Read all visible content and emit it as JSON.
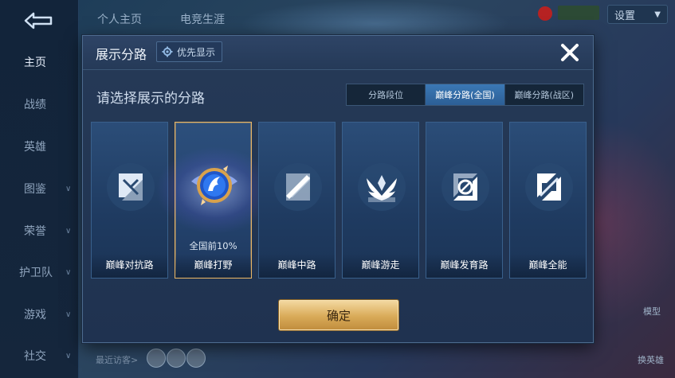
{
  "sidebar": {
    "items": [
      {
        "label": "主页",
        "active": true,
        "chevron": false
      },
      {
        "label": "战绩",
        "active": false,
        "chevron": false
      },
      {
        "label": "英雄",
        "active": false,
        "chevron": false
      },
      {
        "label": "图鉴",
        "active": false,
        "chevron": true
      },
      {
        "label": "荣誉",
        "active": false,
        "chevron": true
      },
      {
        "label": "护卫队",
        "active": false,
        "chevron": true
      },
      {
        "label": "游戏",
        "active": false,
        "chevron": true
      },
      {
        "label": "社交",
        "active": false,
        "chevron": true
      }
    ]
  },
  "top_tabs": [
    "个人主页",
    "电竞生涯"
  ],
  "settings": {
    "label": "设置"
  },
  "bottom": {
    "recent_visitors": "最近访客>"
  },
  "right_labels": {
    "model": "模型",
    "change_hero": "换英雄"
  },
  "modal": {
    "title": "展示分路",
    "priority_label": "优先显示",
    "prompt": "请选择展示的分路",
    "segments": [
      {
        "label": "分路段位",
        "active": false
      },
      {
        "label": "巅峰分路(全国)",
        "active": true
      },
      {
        "label": "巅峰分路(战区)",
        "active": false
      }
    ],
    "cards": [
      {
        "label": "巅峰对抗路",
        "icon": "sword-shield-icon",
        "selected": false,
        "rank": ""
      },
      {
        "label": "巅峰打野",
        "icon": "jungle-emblem-icon",
        "selected": true,
        "rank": "全国前10%"
      },
      {
        "label": "巅峰中路",
        "icon": "mid-lane-icon",
        "selected": false,
        "rank": ""
      },
      {
        "label": "巅峰游走",
        "icon": "wings-icon",
        "selected": false,
        "rank": ""
      },
      {
        "label": "巅峰发育路",
        "icon": "target-icon",
        "selected": false,
        "rank": ""
      },
      {
        "label": "巅峰全能",
        "icon": "all-round-icon",
        "selected": false,
        "rank": ""
      }
    ],
    "confirm_label": "确定"
  },
  "colors": {
    "accent_gold": "#e8b565",
    "active_segment": "#3b78b5",
    "modal_bg": "#263a57"
  }
}
